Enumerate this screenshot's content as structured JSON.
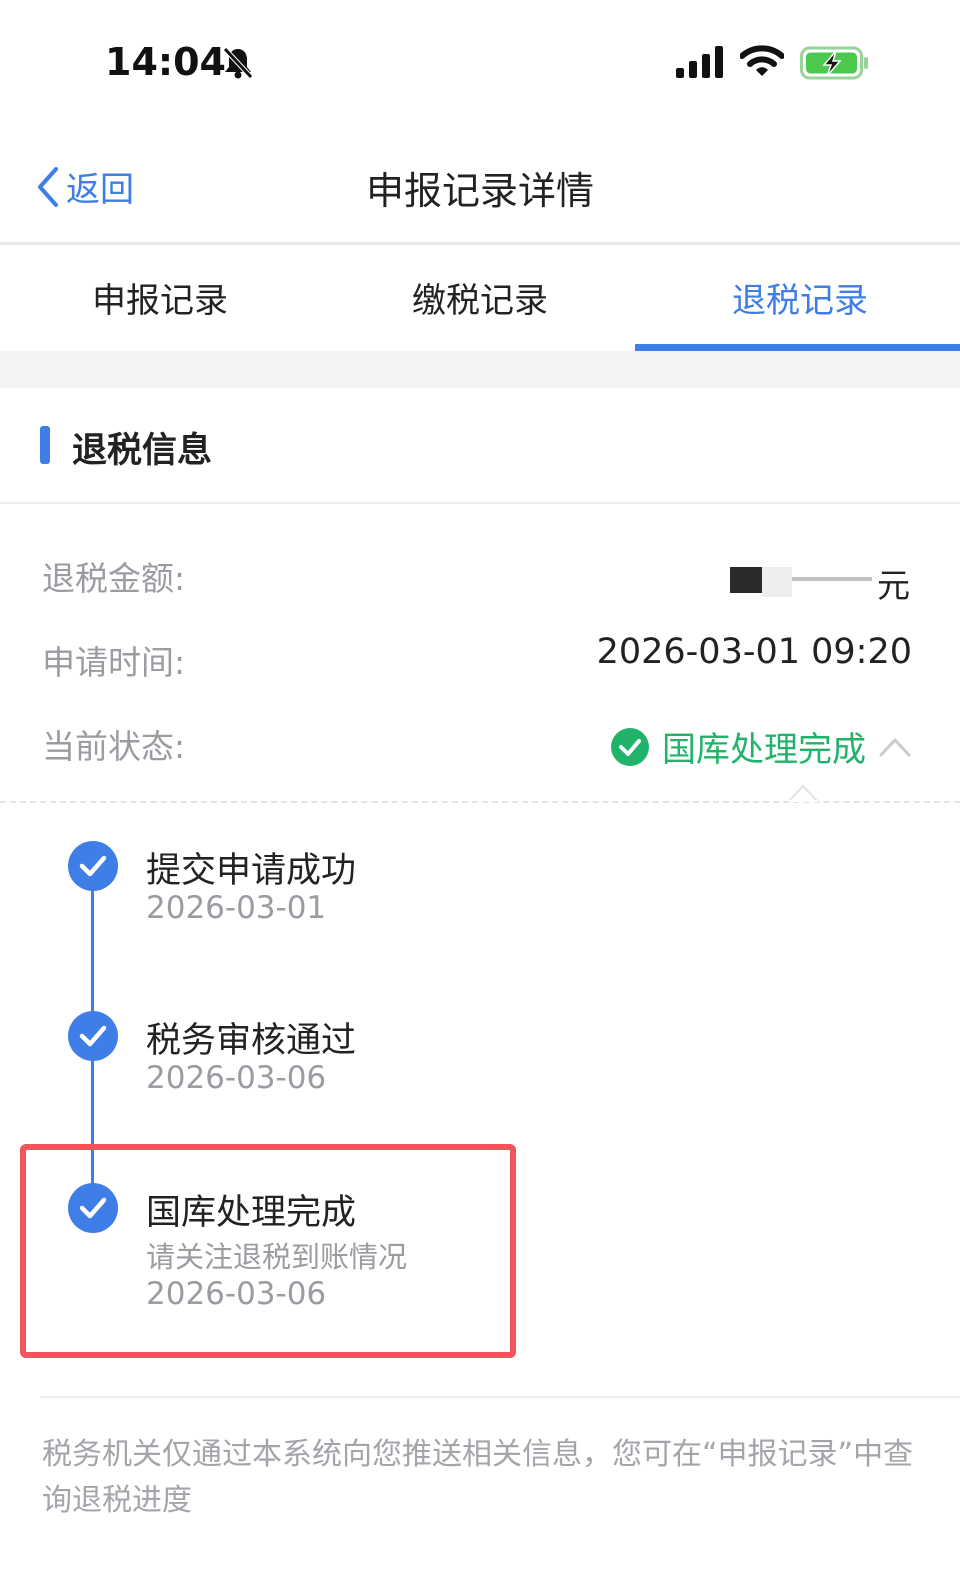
{
  "status_bar": {
    "time": "14:04",
    "icons": [
      "bell-slash-icon",
      "signal-icon",
      "wifi-icon",
      "battery-charging-icon"
    ]
  },
  "nav": {
    "back_label": "返回",
    "title": "申报记录详情"
  },
  "tabs": [
    {
      "label": "申报记录",
      "active": false
    },
    {
      "label": "缴税记录",
      "active": false
    },
    {
      "label": "退税记录",
      "active": true
    }
  ],
  "section": {
    "title": "退税信息"
  },
  "info": {
    "refund_amount_label": "退税金额:",
    "refund_amount_value": "元",
    "apply_time_label": "申请时间:",
    "apply_time_value": "2026-03-01 09:20",
    "status_label": "当前状态:",
    "status_value": "国库处理完成"
  },
  "timeline": [
    {
      "title": "提交申请成功",
      "subtitle": "",
      "date": "2026-03-01"
    },
    {
      "title": "税务审核通过",
      "subtitle": "",
      "date": "2026-03-06"
    },
    {
      "title": "国库处理完成",
      "subtitle": "请关注退税到账情况",
      "date": "2026-03-06"
    }
  ],
  "notice": "税务机关仅通过本系统向您推送相关信息，您可在“申报记录”中查询退税进度",
  "colors": {
    "accent": "#3f7ee6",
    "success": "#22b36b",
    "highlight": "#f0555a"
  }
}
